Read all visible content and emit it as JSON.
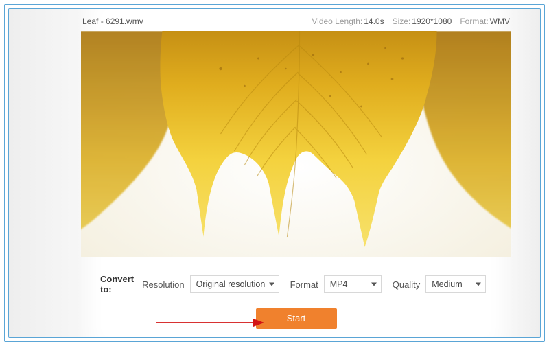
{
  "file": {
    "name": "Leaf - 6291.wmv"
  },
  "meta": {
    "video_length_label": "Video Length:",
    "video_length_value": "14.0s",
    "size_label": "Size:",
    "size_value": "1920*1080",
    "format_label": "Format:",
    "format_value": "WMV"
  },
  "controls": {
    "convert_to_label": "Convert to:",
    "resolution_label": "Resolution",
    "resolution_value": "Original resolution",
    "format_label": "Format",
    "format_value": "MP4",
    "quality_label": "Quality",
    "quality_value": "Medium"
  },
  "actions": {
    "start_label": "Start"
  }
}
